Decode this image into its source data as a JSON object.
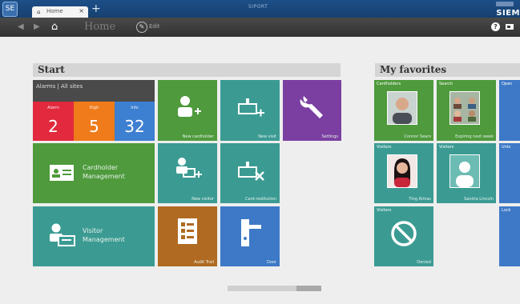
{
  "app": {
    "logo": "SE",
    "tab_label": "Home",
    "tab_close": "×",
    "tab_icon": "home-icon",
    "new_tab": "+",
    "window_title": "SIPORT",
    "brand": "SIEM"
  },
  "toolbar": {
    "back": "◀",
    "forward": "▶",
    "home": "⌂",
    "breadcrumb": "Home",
    "edit": "✎",
    "edit_label": "Edit",
    "help": "?"
  },
  "start": {
    "title": "Start",
    "alarms": {
      "title": "Alarms | All sites",
      "cells": [
        {
          "label": "Alarm",
          "value": "2",
          "color": "#e2293d"
        },
        {
          "label": "High",
          "value": "5",
          "color": "#ef7b1a"
        },
        {
          "label": "Info",
          "value": "32",
          "color": "#3d7fd0"
        }
      ]
    },
    "tiles": {
      "new_cardholder": "New cardholder",
      "new_visit": "New visit",
      "settings": "Settings",
      "cardholder_management": [
        "Cardholder",
        "Management"
      ],
      "new_visitor": "New visitor",
      "card_restitution": "Card restitution",
      "visitor_management": [
        "Visitor",
        "Management"
      ],
      "audit_trail": "Audit Trail",
      "door": "Door"
    }
  },
  "favorites": {
    "title": "My favorites",
    "items": [
      {
        "head": "Cardholders",
        "name": "Connor Sears"
      },
      {
        "head": "Search",
        "name": "Expiring next week"
      },
      {
        "head": "Open",
        "name": ""
      },
      {
        "head": "Visitors",
        "name": "Ting Almas"
      },
      {
        "head": "Visitors",
        "name": "Sandra Lincoln"
      },
      {
        "head": "Unlo",
        "name": ""
      },
      {
        "head": "Visitors",
        "name": "Denied"
      },
      {
        "head": "Lock",
        "name": ""
      }
    ]
  },
  "colors": {
    "green": "#4e9a3c",
    "teal": "#3b9b93",
    "purple": "#7b3fa1",
    "brown": "#b06a21",
    "blue": "#3d79c7"
  }
}
